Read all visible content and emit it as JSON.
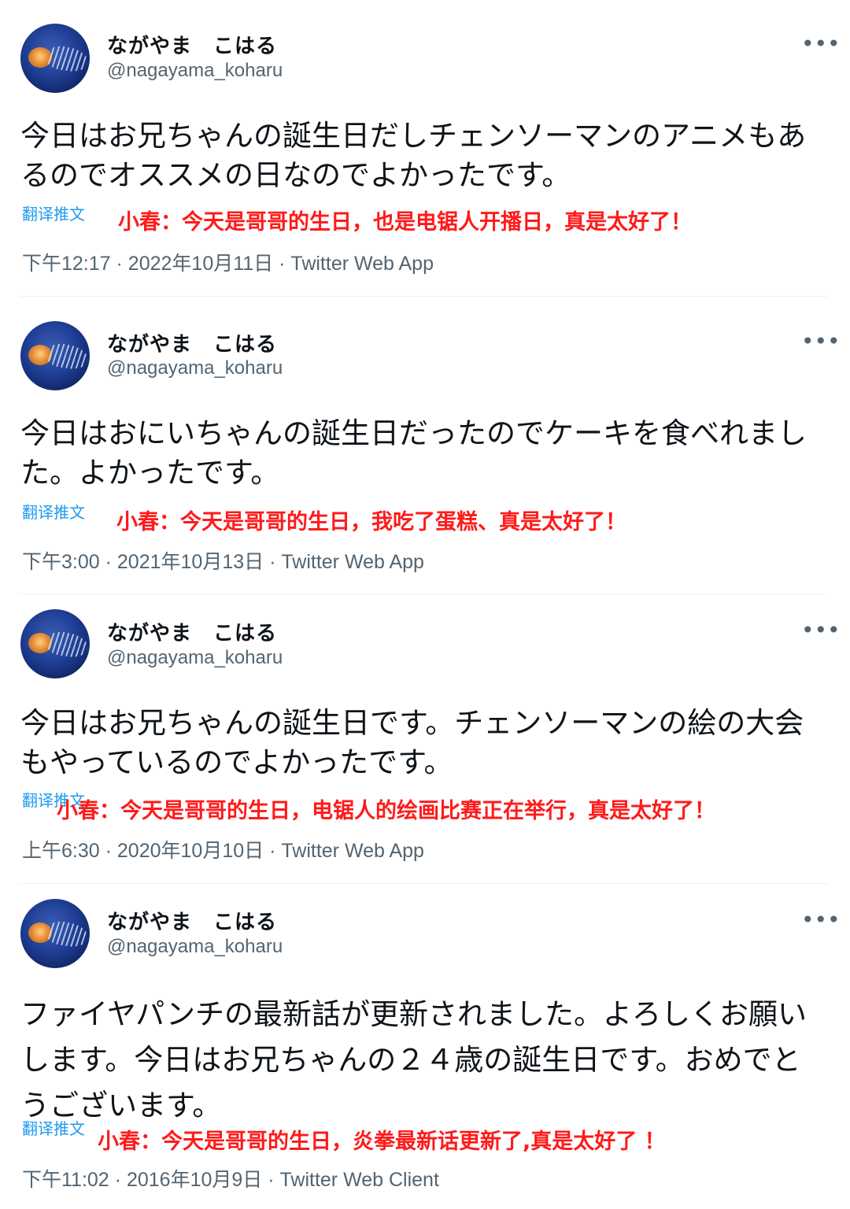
{
  "tweets": [
    {
      "display_name": "ながやま　こはる",
      "handle": "@nagayama_koharu",
      "more_label": "•••",
      "text": "今日はお兄ちゃんの誕生日だしチェンソーマンのアニメもあるのでオススメの日なのでよかったです。",
      "translate_label": "翻译推文",
      "caption": "小春：今天是哥哥的生日，也是电锯人开播日，真是太好了！",
      "time": "下午12:17",
      "date": "2022年10月11日",
      "source": "Twitter Web App"
    },
    {
      "display_name": "ながやま　こはる",
      "handle": "@nagayama_koharu",
      "more_label": "•••",
      "text": "今日はおにいちゃんの誕生日だったのでケーキを食べれました。よかったです。",
      "translate_label": "翻译推文",
      "caption": "小春：今天是哥哥的生日，我吃了蛋糕、真是太好了！",
      "time": "下午3:00",
      "date": "2021年10月13日",
      "source": "Twitter Web App"
    },
    {
      "display_name": "ながやま　こはる",
      "handle": "@nagayama_koharu",
      "more_label": "•••",
      "text": "今日はお兄ちゃんの誕生日です。チェンソーマンの絵の大会もやっているのでよかったです。",
      "translate_label": "翻译推文",
      "caption": "小春：今天是哥哥的生日，电锯人的绘画比赛正在举行，真是太好了！",
      "time": "上午6:30",
      "date": "2020年10月10日",
      "source": "Twitter Web App"
    },
    {
      "display_name": "ながやま　こはる",
      "handle": "@nagayama_koharu",
      "more_label": "•••",
      "text": "ファイヤパンチの最新話が更新されました。よろしくお願いします。今日はお兄ちゃんの２４歳の誕生日です。おめでとうございます。",
      "translate_label": "翻译推文",
      "caption": "小春：今天是哥哥的生日，炎拳最新话更新了,真是太好了 ！",
      "time": "下午11:02",
      "date": "2016年10月9日",
      "source": "Twitter Web Client"
    }
  ],
  "colors": {
    "text": "#0f1419",
    "secondary": "#536471",
    "link": "#1d9bf0",
    "caption": "#ff1a1a",
    "divider": "#eff3f4"
  }
}
